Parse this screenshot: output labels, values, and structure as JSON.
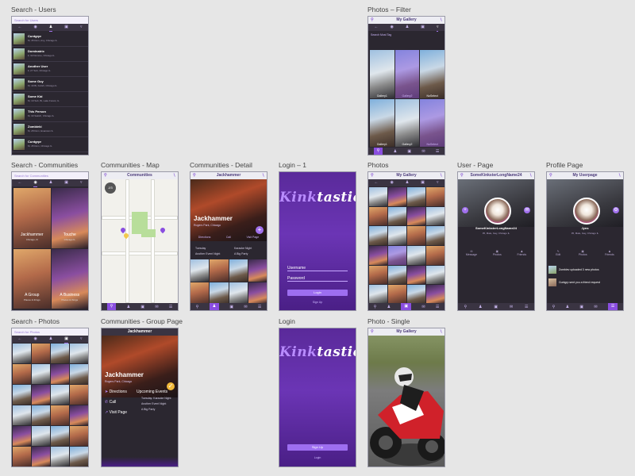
{
  "boards": {
    "search_users": {
      "label": "Search - Users",
      "search_placeholder": "Search for Users",
      "users": [
        {
          "name": "Cuntgrpr",
          "detail": "M, 45 Dom, Any, Chicago IL"
        },
        {
          "name": "Dominatrix",
          "detail": "F, 32 Domme, Chicago IL"
        },
        {
          "name": "Another User",
          "detail": "F, 27 Sub, Chicago IL"
        },
        {
          "name": "Some Guy",
          "detail": "M, 40 Bi, Fetish, Chicago IL"
        },
        {
          "name": "Some Kid",
          "detail": "M, 19 Sub, Bi, Lake Forest, IL"
        },
        {
          "name": "This Person",
          "detail": "M, 33 Switch, Chicago IL"
        },
        {
          "name": "Zombieki",
          "detail": "M, 28 Dom, Evanston IL"
        },
        {
          "name": "Cuntgrpr",
          "detail": "M, 45 Dom, Chicago IL"
        }
      ]
    },
    "photos_filter": {
      "label": "Photos – Filter",
      "header": "My Gallery",
      "section": "Search Most Tag",
      "captions": [
        "Gallery1",
        "Gallery2",
        "NoSelect",
        "Gallery1",
        "Gallery2",
        "NoSelect"
      ]
    },
    "search_communities": {
      "label": "Search - Communities",
      "search_placeholder": "Search for Communities",
      "items": [
        {
          "name": "Jackhammer",
          "place": "Chicago, Ill"
        },
        {
          "name": "Touche",
          "place": "Chicago IL"
        },
        {
          "name": "A Group",
          "place": "Places & things"
        },
        {
          "name": "A Business",
          "place": "Places & things"
        }
      ]
    },
    "communities_map": {
      "label": "Communities - Map",
      "header": "Communities",
      "avatar_text": "J/3"
    },
    "communities_detail": {
      "label": "Communities - Detail",
      "header": "Jackhammer",
      "title": "Jackhammer",
      "subtitle": "Rogers Park, Chicago",
      "tabs": [
        "Directions",
        "Call",
        "Visit Page"
      ],
      "events": [
        {
          "left": "Tuesday",
          "right": "Karaoke Night"
        },
        {
          "left": "Another Event Night",
          "right": "A Big Party"
        }
      ]
    },
    "login_1": {
      "label": "Login – 1",
      "logo_prefix": "Kink",
      "logo_suffix": "tastic",
      "username_label": "Username",
      "password_label": "Password",
      "login_button": "Login",
      "signup_link": "Sign Up"
    },
    "photos": {
      "label": "Photos",
      "header": "My Gallery"
    },
    "user_page": {
      "label": "User - Page",
      "header": "SomeKinksterLongName24",
      "name": "SomeKinksterLongName24",
      "info": "35, Male, Gay, Chicago IL",
      "actions": [
        "Message",
        "Photos",
        "Friends"
      ]
    },
    "profile_page": {
      "label": "Profile Page",
      "header": "My Userpage",
      "name": "Jyns",
      "info": "35, Male, Gay, Chicago IL",
      "actions": [
        "Edit",
        "Photos",
        "Friends"
      ],
      "feed": [
        "Zombiev uploaded 3 new photos",
        "Cuntgrp sent you a friend request"
      ]
    },
    "search_photos": {
      "label": "Search - Photos",
      "search_placeholder": "Search for Photos"
    },
    "communities_group": {
      "label": "Communities - Group Page",
      "header": "Jackhammer",
      "title": "Jackhammer",
      "subtitle": "Rogers Park, Chicago",
      "actions": [
        "Directions",
        "Call",
        "Visit Page"
      ],
      "events_title": "Upcoming Events",
      "events": [
        "Tuesday: Karaoke Night",
        "Another Event Night",
        "A Big Party"
      ]
    },
    "login": {
      "label": "Login",
      "logo_prefix": "Kink",
      "logo_suffix": "tastic",
      "signup_button": "Sign Up",
      "login_link": "Login"
    },
    "photo_single": {
      "label": "Photo - Single",
      "header": "My Gallery"
    }
  },
  "colors": {
    "canvas": "#e6e6e6",
    "brand_purple": "#6b35b5",
    "accent": "#a070ec",
    "dark_bg": "#2b2730"
  }
}
